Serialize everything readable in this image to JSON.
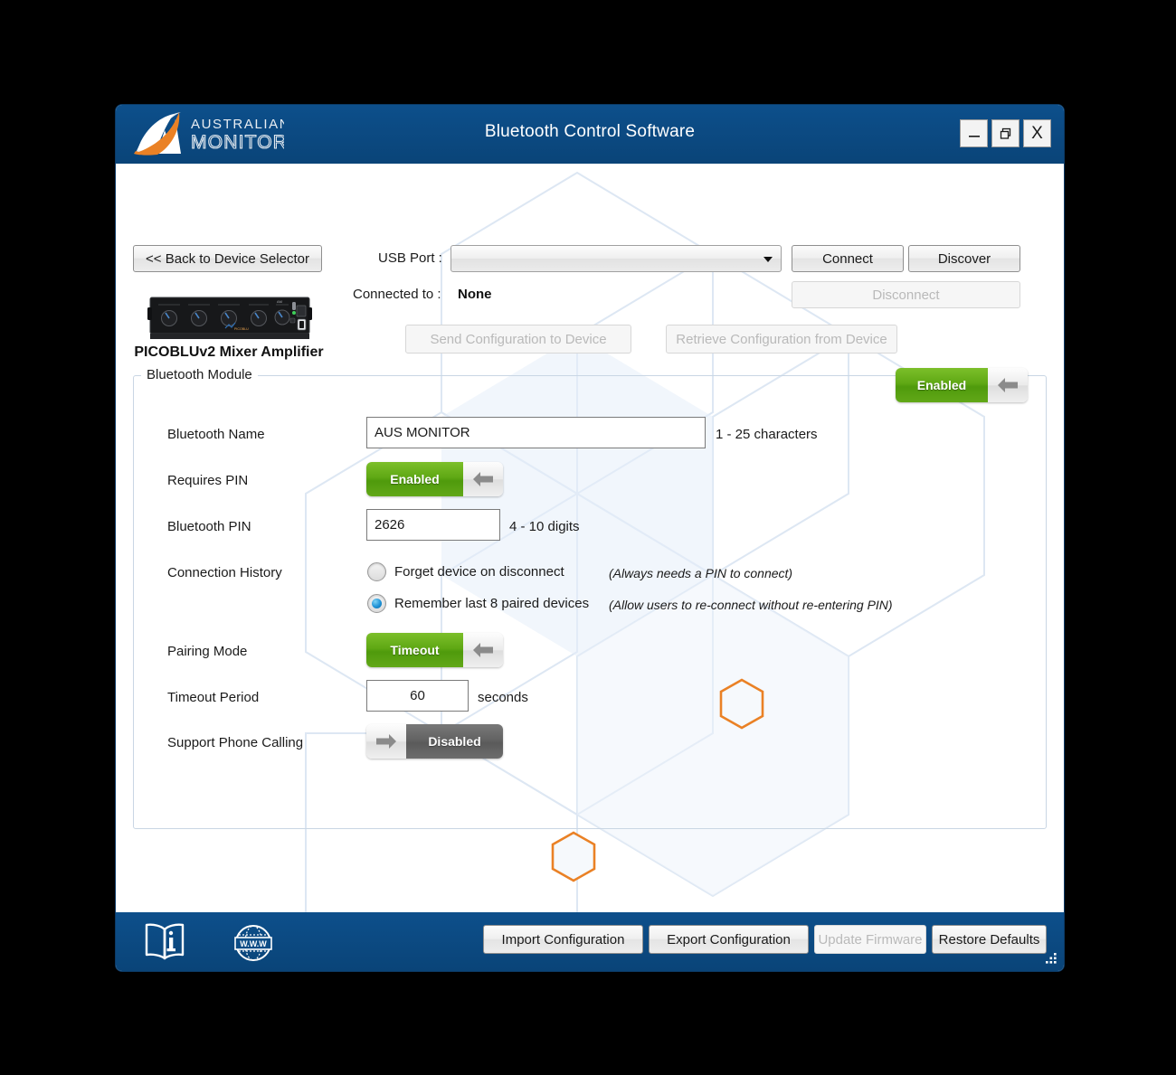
{
  "window": {
    "title": "Bluetooth Control Software",
    "minimize_label": "–",
    "restore_label": "❐",
    "close_label": "X",
    "brand_line1": "AUSTRALIAN",
    "brand_line2": "MONITOR",
    "accent_blue": "#0b4c86",
    "accent_orange": "#ea8125"
  },
  "toolbar": {
    "back_label": "<<  Back to Device Selector",
    "usb_port_label": "USB Port :",
    "usb_port_value": "",
    "usb_port_placeholder": "",
    "connect_label": "Connect",
    "discover_label": "Discover",
    "disconnect_label": "Disconnect",
    "connected_to_label": "Connected to :",
    "connected_to_value": "None",
    "send_config_label": "Send Configuration to Device",
    "retrieve_config_label": "Retrieve Configuration from Device"
  },
  "device": {
    "name": "PICOBLUv2 Mixer Amplifier"
  },
  "bluetooth_module": {
    "group_title": "Bluetooth Module",
    "module_toggle": {
      "state_label": "Enabled",
      "on": true
    },
    "rows": {
      "bt_name": {
        "label": "Bluetooth Name",
        "value": "AUS MONITOR",
        "hint": "1 - 25 characters"
      },
      "requires_pin": {
        "label": "Requires PIN",
        "state_label": "Enabled",
        "on": true
      },
      "bt_pin": {
        "label": "Bluetooth PIN",
        "value": "2626",
        "hint": "4 - 10 digits"
      },
      "connection_history": {
        "label": "Connection History",
        "options": [
          {
            "label": "Forget device on disconnect",
            "note": "(Always needs a PIN to connect)",
            "selected": false
          },
          {
            "label": "Remember last 8 paired devices",
            "note": "(Allow users to re-connect without re-entering PIN)",
            "selected": true
          }
        ]
      },
      "pairing_mode": {
        "label": "Pairing Mode",
        "state_label": "Timeout",
        "on": true
      },
      "timeout_period": {
        "label": "Timeout Period",
        "value": "60",
        "hint": "seconds"
      },
      "support_phone_calling": {
        "label": "Support Phone Calling",
        "state_label": "Disabled",
        "on": false
      }
    }
  },
  "footer": {
    "manual_icon": "book-info-icon",
    "web_icon": "globe-www-icon",
    "web_icon_text": "W.W.W",
    "import_label": "Import Configuration",
    "export_label": "Export Configuration",
    "firmware_label": "Update Firmware",
    "restore_label": "Restore Defaults"
  }
}
